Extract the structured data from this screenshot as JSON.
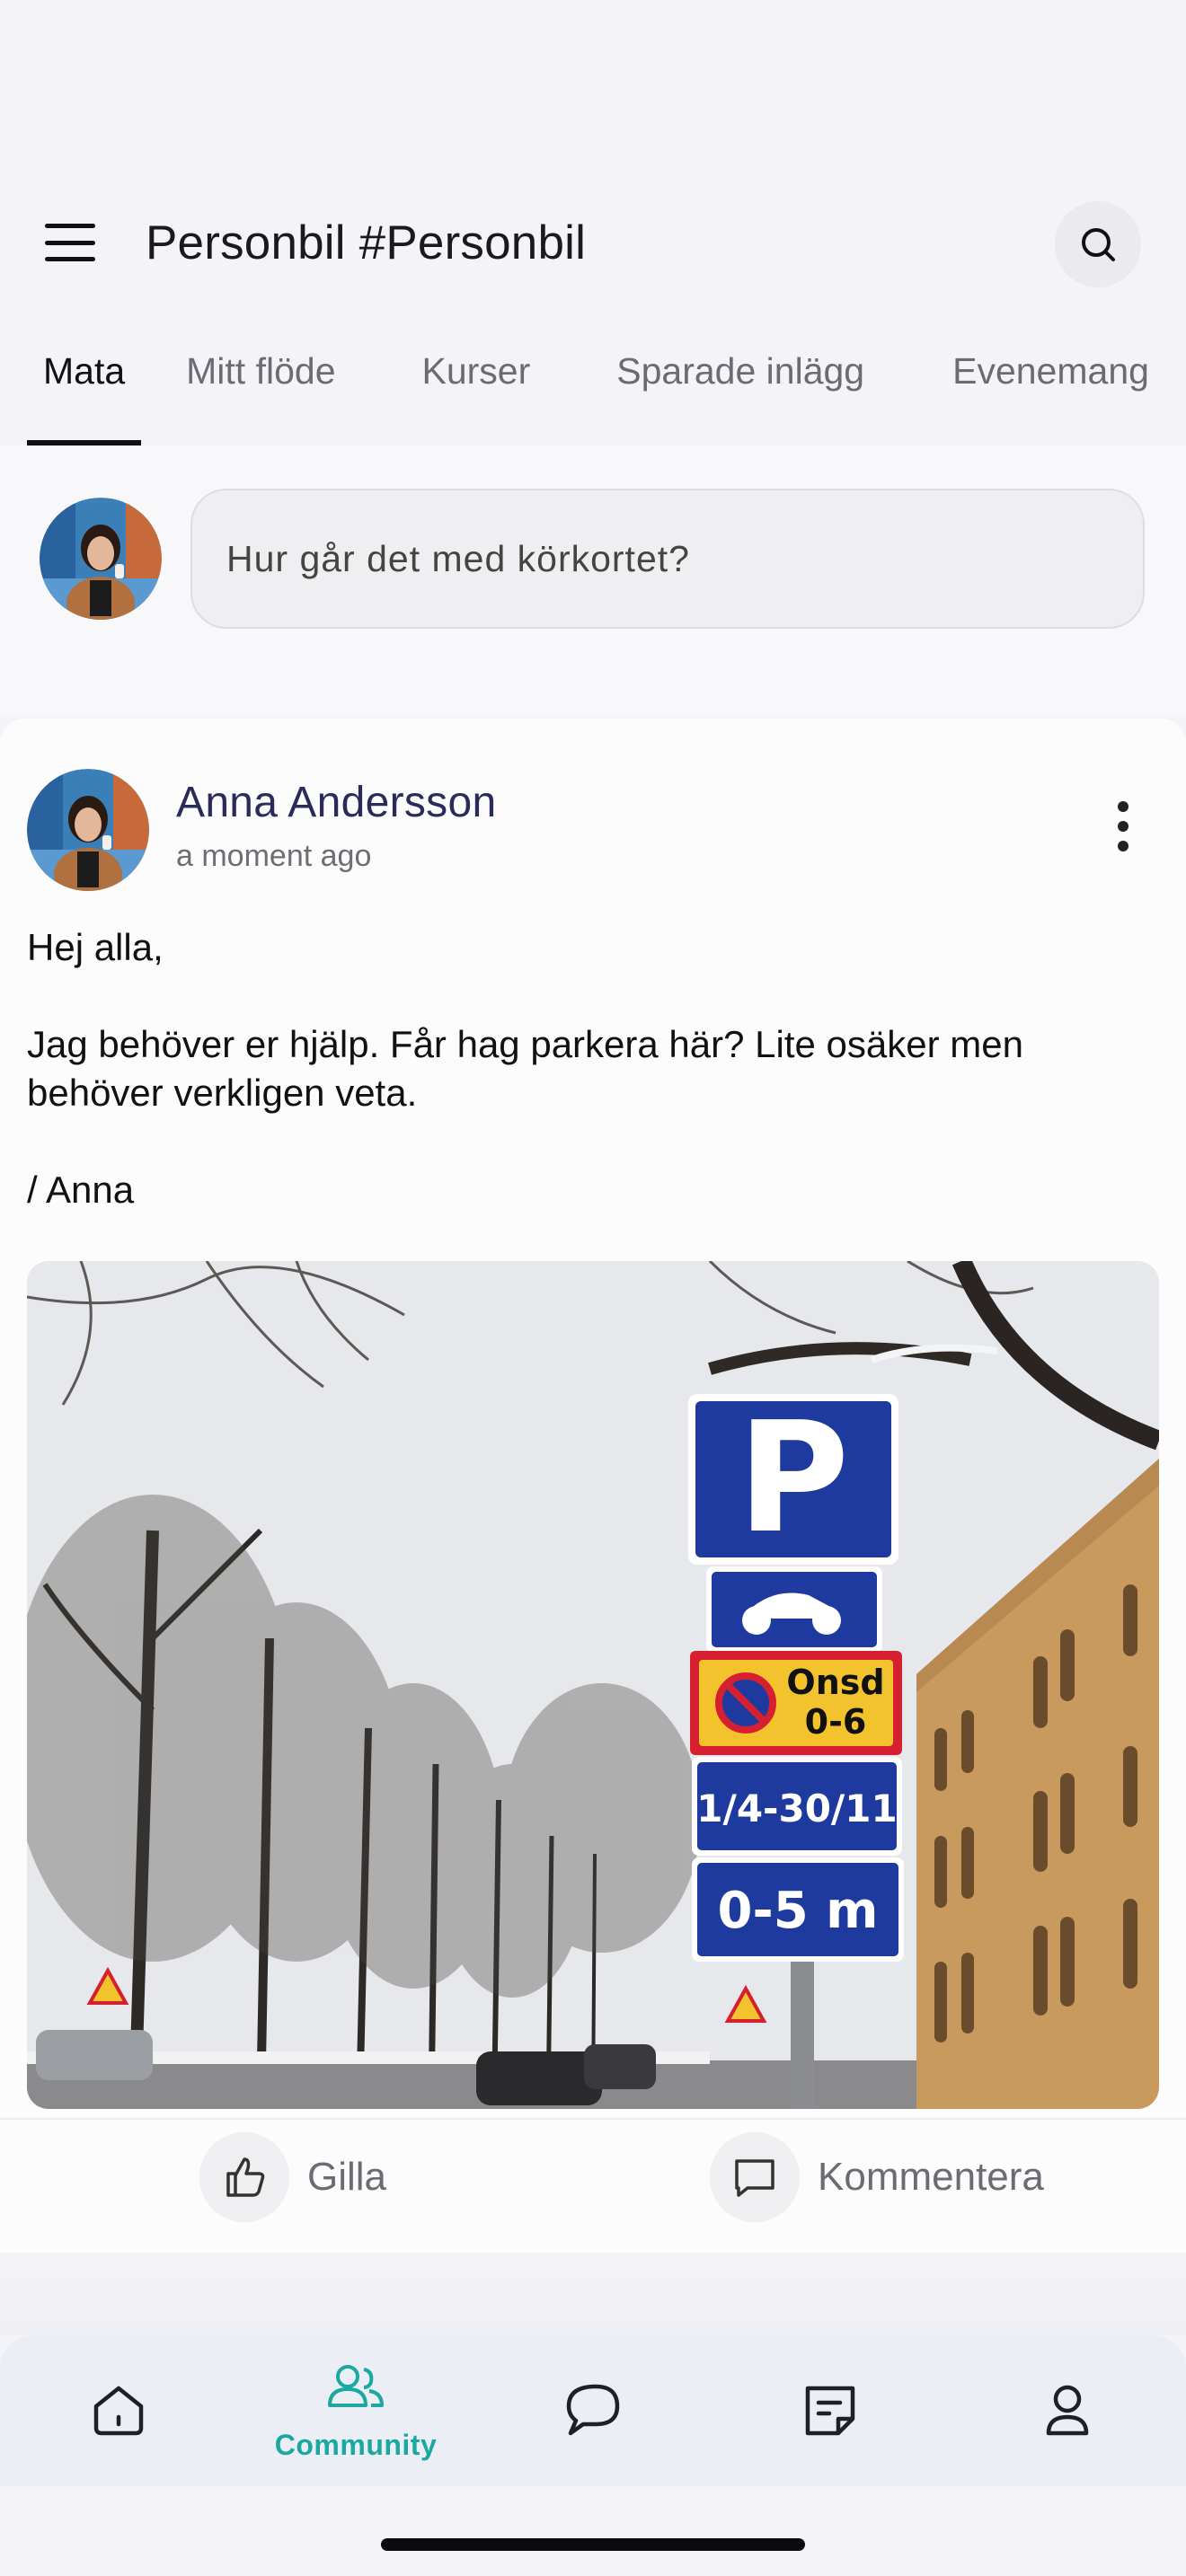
{
  "header": {
    "title": "Personbil #Personbil",
    "menu_icon": "hamburger-menu-icon",
    "search_icon": "search-icon"
  },
  "tabs": [
    {
      "label": "Mata",
      "active": true
    },
    {
      "label": "Mitt flöde",
      "active": false
    },
    {
      "label": "Kurser",
      "active": false
    },
    {
      "label": "Sparade inlägg",
      "active": false
    },
    {
      "label": "Evenemang",
      "active": false
    }
  ],
  "composer": {
    "placeholder": "Hur går det med körkortet?"
  },
  "post": {
    "author": "Anna Andersson",
    "time": "a moment ago",
    "body": {
      "greeting": "Hej alla,",
      "message": "Jag behöver er hjälp. Får hag parkera här? Lite osäker men behöver verkligen veta.",
      "signature": "/ Anna"
    },
    "image": {
      "sign_p": "P",
      "sign_day": "Onsd",
      "sign_hours": "0-6",
      "sign_period": "1/4-30/11",
      "sign_distance": "0-5 m"
    },
    "actions": {
      "like_label": "Gilla",
      "comment_label": "Kommentera"
    }
  },
  "bottom_nav": {
    "items": [
      {
        "icon": "home-icon",
        "label": ""
      },
      {
        "icon": "community-icon",
        "label": "Community",
        "active": true
      },
      {
        "icon": "chat-icon",
        "label": ""
      },
      {
        "icon": "notes-icon",
        "label": ""
      },
      {
        "icon": "profile-icon",
        "label": ""
      }
    ]
  },
  "colors": {
    "accent": "#1aa8a0",
    "author": "#2b2b5a",
    "background": "#f4f4f8"
  }
}
